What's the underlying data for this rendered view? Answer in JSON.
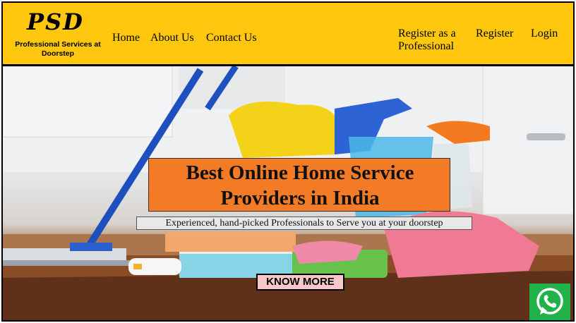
{
  "logo": {
    "title": "PSD",
    "subtitle": "Professional Services at Doorstep"
  },
  "nav": {
    "home": "Home",
    "about": "About Us",
    "contact": "Contact Us",
    "register_professional": "Register as a Professional",
    "register": "Register",
    "login": "Login"
  },
  "hero": {
    "headline": "Best Online Home Service Providers in India",
    "subtitle": "Experienced, hand-picked Professionals to Serve you at your doorstep",
    "cta": "KNOW MORE"
  },
  "colors": {
    "header_bg": "#ffc70d",
    "headline_bg": "#f47b26",
    "cta_bg": "#f8c8c8",
    "whatsapp": "#21b34a"
  },
  "icons": {
    "whatsapp": "whatsapp-icon"
  }
}
